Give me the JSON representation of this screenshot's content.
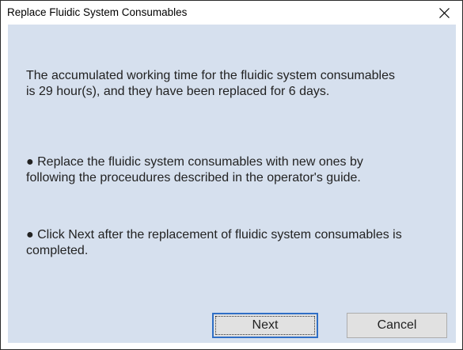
{
  "window": {
    "title": "Replace Fluidic System Consumables",
    "close_icon": "close-icon"
  },
  "message": {
    "paragraph1": "The accumulated working time for the fluidic system consumables is 29 hour(s), and they have been replaced for 6 days.",
    "paragraph2": "●  Replace the fluidic system consumables with new ones by following the proceudures described in the operator's guide.",
    "paragraph3": "●  Click Next after the replacement of fluidic system consumables is completed."
  },
  "buttons": {
    "next_label": "Next",
    "cancel_label": "Cancel"
  },
  "colors": {
    "content_background": "#d6e0ee",
    "default_button_border": "#2f6fc6"
  }
}
